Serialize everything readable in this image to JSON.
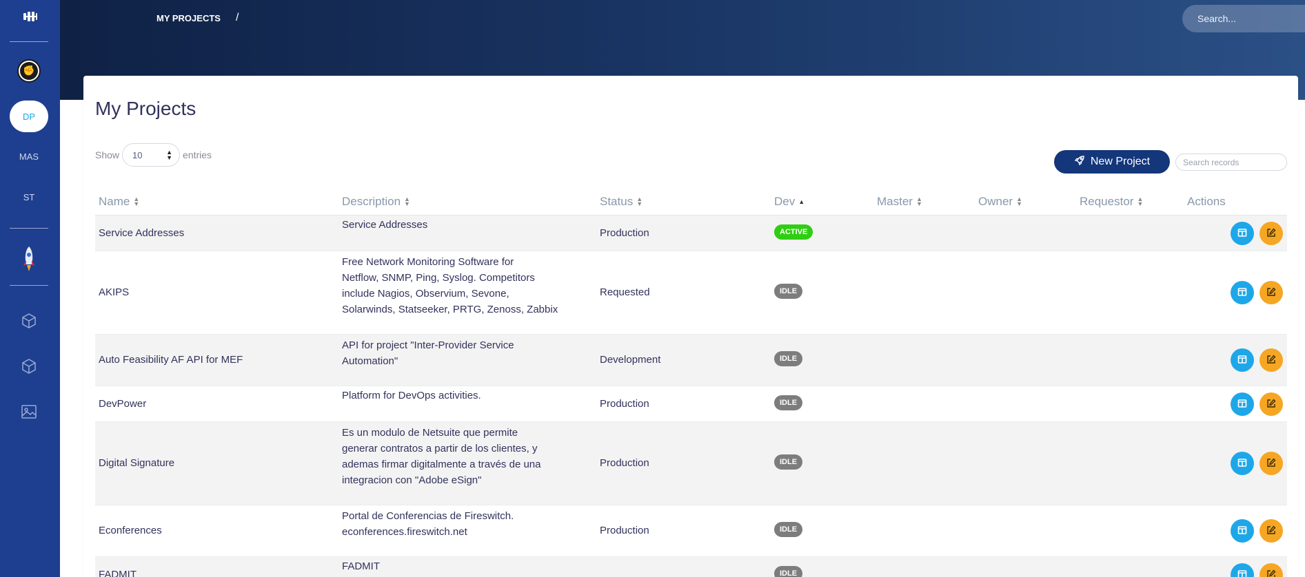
{
  "header": {
    "breadcrumb": "MY PROJECTS",
    "breadcrumb_separator": "/",
    "search_placeholder": "Search..."
  },
  "sidebar": {
    "logo_icon": "grip-icon",
    "items": [
      {
        "label": "DP",
        "active": true
      },
      {
        "label": "MAS",
        "active": false
      },
      {
        "label": "ST",
        "active": false
      }
    ],
    "bottom_icons": [
      "cube-icon",
      "cube-icon",
      "image-icon"
    ]
  },
  "page": {
    "title": "My Projects",
    "show_label": "Show",
    "entries_value": "10",
    "entries_label": "entries",
    "new_project_label": "New Project",
    "search_records_placeholder": "Search records"
  },
  "table": {
    "columns": [
      "Name",
      "Description",
      "Status",
      "Dev",
      "Master",
      "Owner",
      "Requestor",
      "Actions"
    ],
    "sorted_column": "Dev",
    "rows": [
      {
        "name": "Service Addresses",
        "description": [
          "Service Addresses"
        ],
        "status": "Production",
        "dev": "ACTIVE"
      },
      {
        "name": "AKIPS",
        "description": [
          "Free Network Monitoring Software for",
          "Netflow, SNMP, Ping, Syslog. Competitors",
          "include Nagios, Observium, Sevone,",
          "Solarwinds, Statseeker, PRTG, Zenoss, Zabbix"
        ],
        "status": "Requested",
        "dev": "IDLE"
      },
      {
        "name": "Auto Feasibility  AF API for MEF",
        "description": [
          "API for project \"Inter-Provider Service",
          "Automation\""
        ],
        "status": "Development",
        "dev": "IDLE"
      },
      {
        "name": "DevPower",
        "description": [
          "Platform for DevOps activities."
        ],
        "status": "Production",
        "dev": "IDLE"
      },
      {
        "name": "Digital Signature",
        "description": [
          "Es un modulo de Netsuite que permite",
          "generar contratos a partir de los clientes, y",
          "ademas firmar digitalmente a través de una",
          "integracion con \"Adobe eSign\""
        ],
        "status": "Production",
        "dev": "IDLE"
      },
      {
        "name": "Econferences",
        "description": [
          "Portal de Conferencias de Fireswitch.",
          "econferences.fireswitch.net"
        ],
        "status": "Production",
        "dev": "IDLE"
      },
      {
        "name": "FADMIT",
        "description": [
          "FADMIT"
        ],
        "status": "",
        "dev": "IDLE"
      }
    ]
  },
  "colors": {
    "sidebar": "#1e3f8f",
    "header_start": "#0f2145",
    "header_end": "#2b5086",
    "button_primary": "#14367a",
    "badge_active": "#2fce12",
    "badge_idle": "#7d7d7d",
    "action_view": "#1ea7e8",
    "action_edit": "#f5a623",
    "active_pill_text": "#11a9ef"
  }
}
